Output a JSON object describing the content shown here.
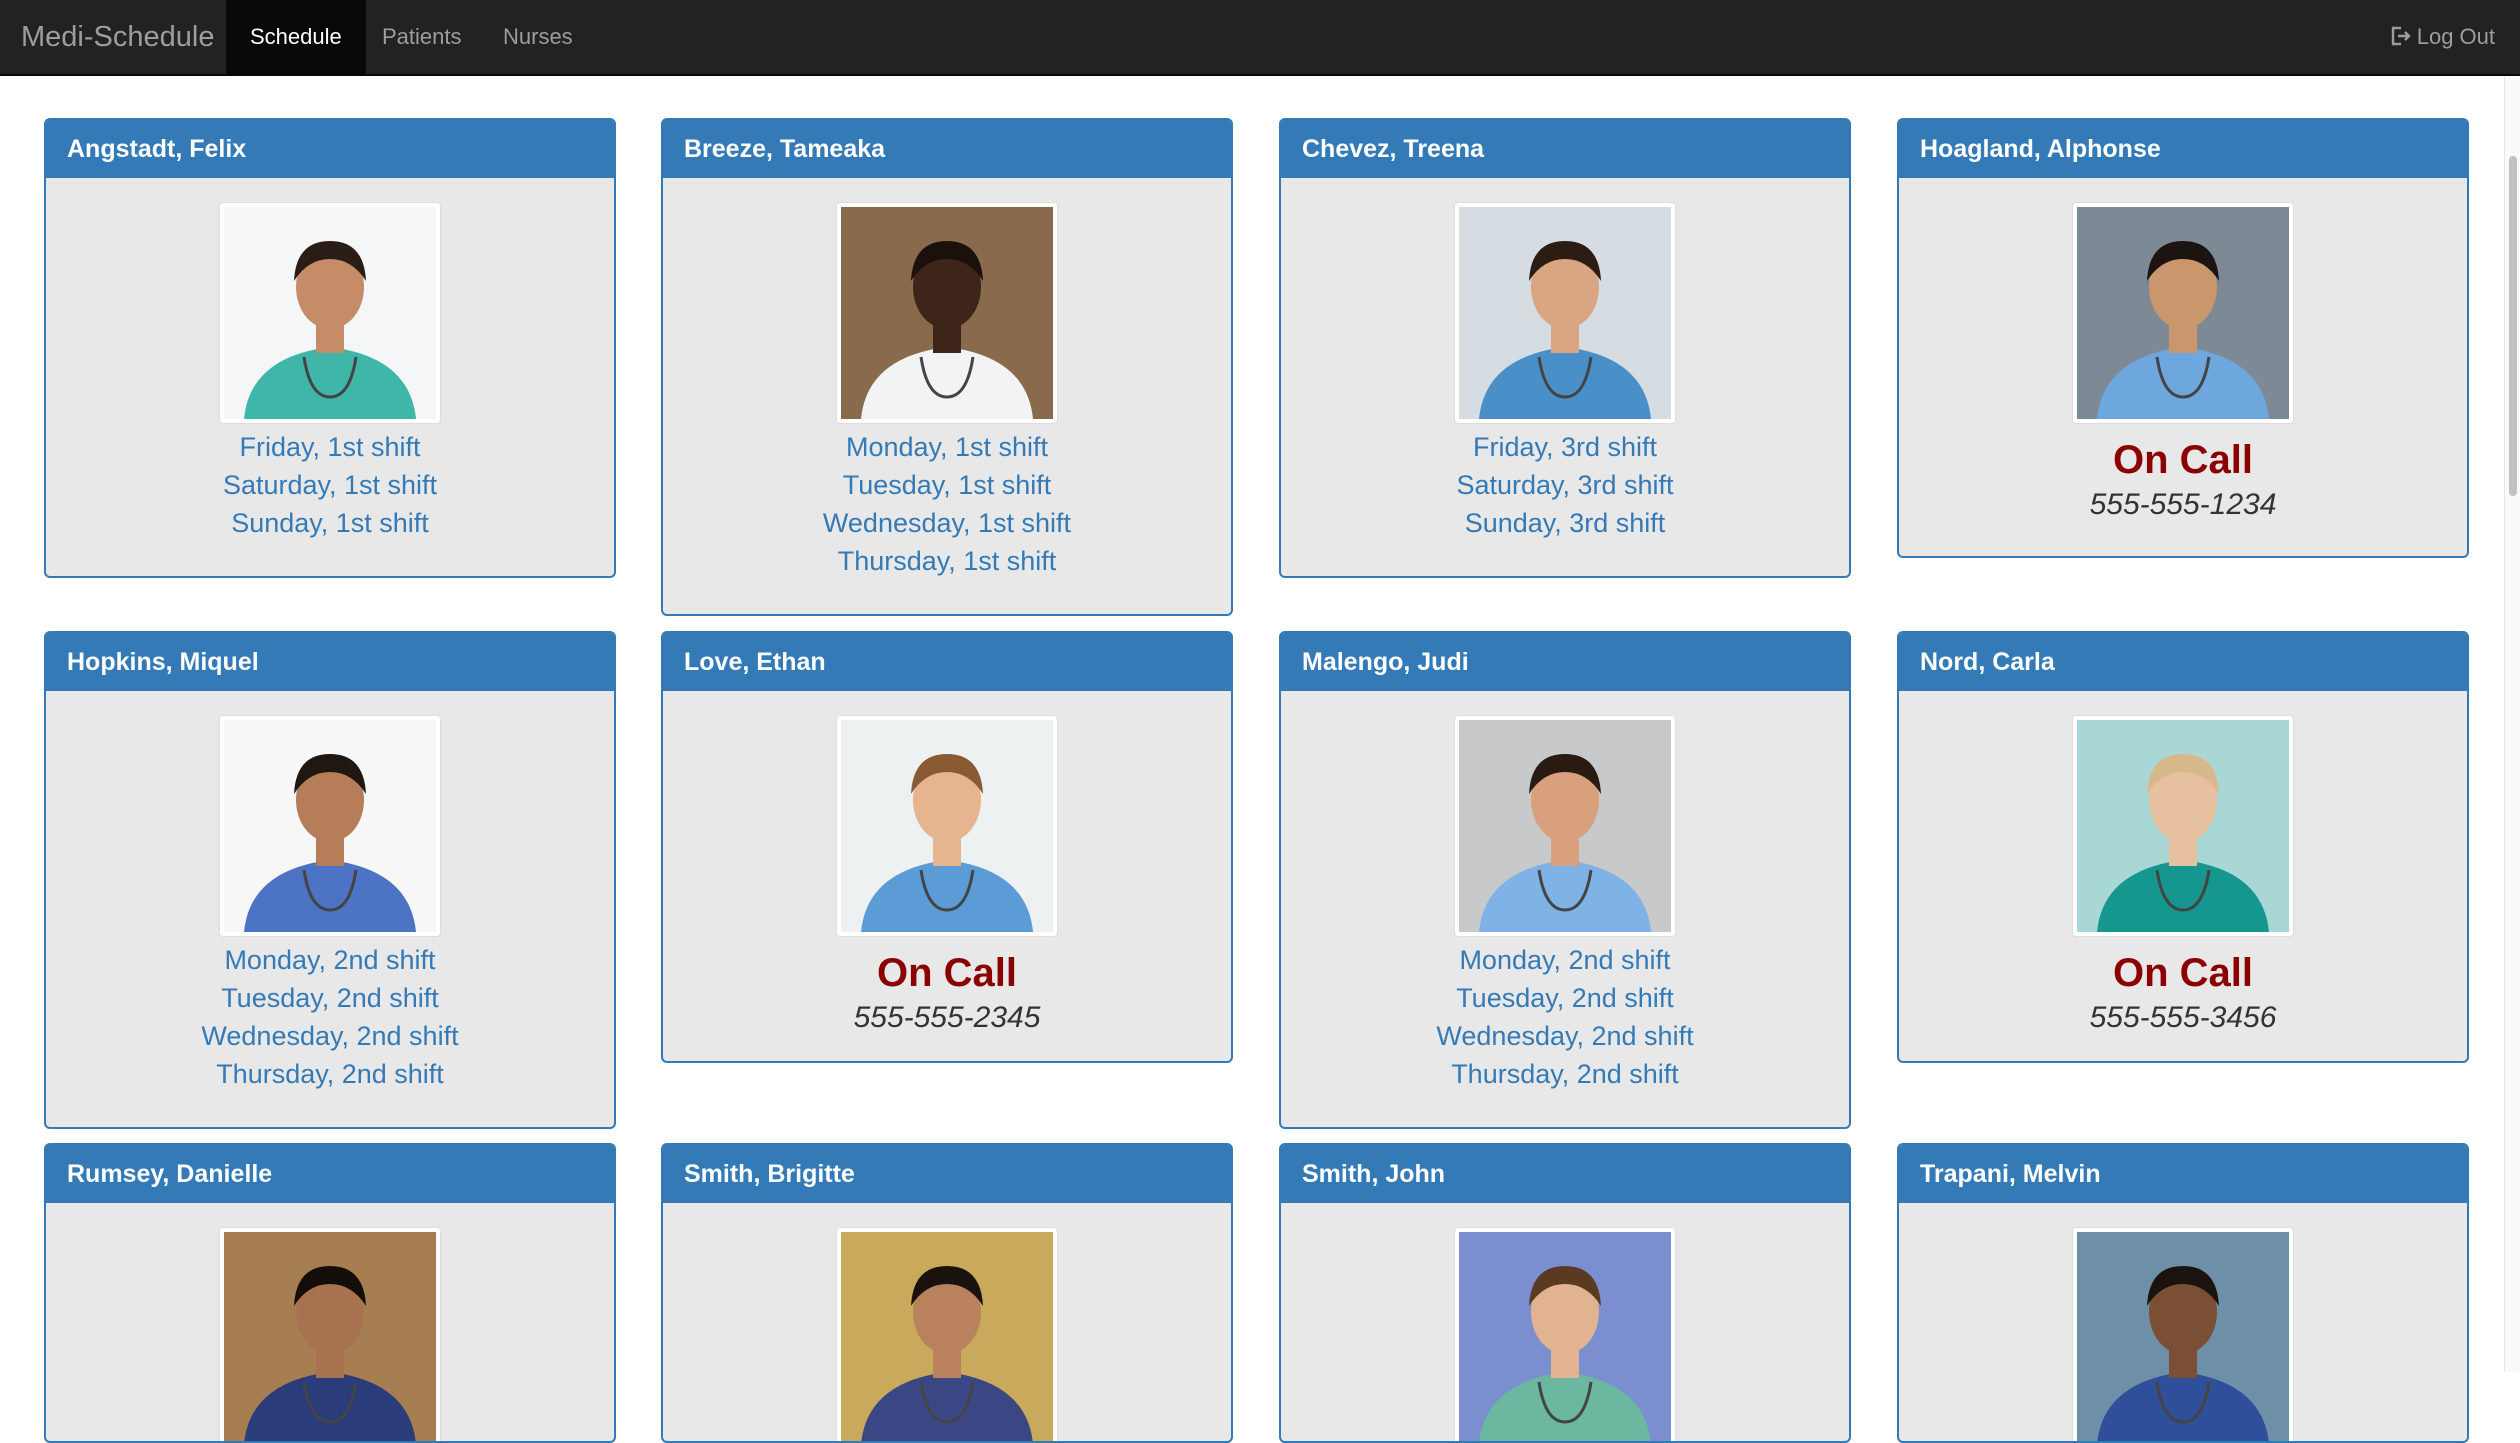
{
  "nav": {
    "brand": "Medi-Schedule",
    "items": [
      {
        "label": "Schedule",
        "active": true
      },
      {
        "label": "Patients",
        "active": false
      },
      {
        "label": "Nurses",
        "active": false
      }
    ],
    "logout": "Log Out"
  },
  "colors": {
    "navbar": "#222222",
    "primary": "#337ab7",
    "card_bg": "#e8e8e8",
    "on_call": "#8b0000"
  },
  "nurses": [
    {
      "name": "Angstadt, Felix",
      "shifts": [
        "Friday, 1st shift",
        "Saturday, 1st shift",
        "Sunday, 1st shift"
      ]
    },
    {
      "name": "Breeze, Tameaka",
      "shifts": [
        "Monday, 1st shift",
        "Tuesday, 1st shift",
        "Wednesday, 1st shift",
        "Thursday, 1st shift"
      ]
    },
    {
      "name": "Chevez, Treena",
      "shifts": [
        "Friday, 3rd shift",
        "Saturday, 3rd shift",
        "Sunday, 3rd shift"
      ]
    },
    {
      "name": "Hoagland, Alphonse",
      "on_call": "On Call",
      "phone": "555-555-1234"
    },
    {
      "name": "Hopkins, Miquel",
      "shifts": [
        "Monday, 2nd shift",
        "Tuesday, 2nd shift",
        "Wednesday, 2nd shift",
        "Thursday, 2nd shift"
      ]
    },
    {
      "name": "Love, Ethan",
      "on_call": "On Call",
      "phone": "555-555-2345"
    },
    {
      "name": "Malengo, Judi",
      "shifts": [
        "Monday, 2nd shift",
        "Tuesday, 2nd shift",
        "Wednesday, 2nd shift",
        "Thursday, 2nd shift"
      ]
    },
    {
      "name": "Nord, Carla",
      "on_call": "On Call",
      "phone": "555-555-3456"
    },
    {
      "name": "Rumsey, Danielle",
      "shifts": []
    },
    {
      "name": "Smith, Brigitte",
      "shifts": []
    },
    {
      "name": "Smith, John",
      "shifts": []
    },
    {
      "name": "Trapani, Melvin",
      "shifts": []
    }
  ]
}
